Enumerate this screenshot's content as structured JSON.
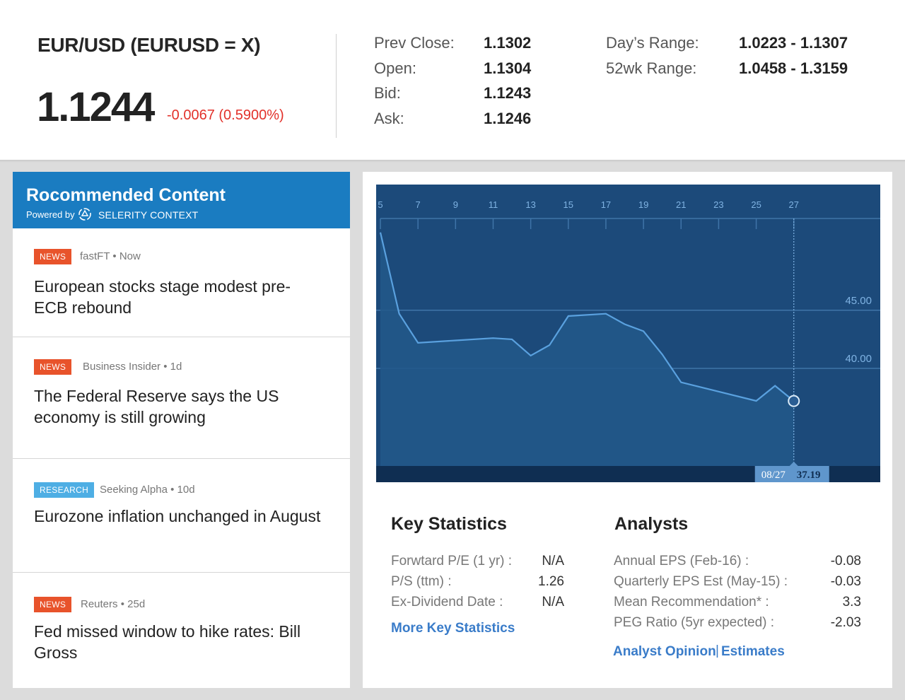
{
  "quote": {
    "name": "EUR/USD (EURUSD = X)",
    "price": "1.1244",
    "change": "-0.0067 (0.5900%)",
    "prev_close_label": "Prev Close:",
    "prev_close": "1.1302",
    "open_label": "Open:",
    "open": "1.1304",
    "bid_label": "Bid:",
    "bid": "1.1243",
    "ask_label": "Ask:",
    "ask": "1.1246",
    "days_range_label": "Day’s Range:",
    "days_range": "1.0223 - 1.1307",
    "wk52_range_label": "52wk Range:",
    "wk52_range": "1.0458 - 1.3159",
    "change_color": "#e2312a"
  },
  "recommended": {
    "title": "Rocommended Content",
    "powered_by": "Powered by",
    "brand": "SELERITY CONTEXT",
    "header_color": "#1a7cc1",
    "items": [
      {
        "tag": "NEWS",
        "tag_type": "news",
        "source": "fastFT",
        "age": "Now",
        "headline": "European stocks stage modest pre-ECB rebound"
      },
      {
        "tag": "NEWS",
        "tag_type": "news",
        "source": "Business Insider",
        "age": "1d",
        "headline": "The Federal Reserve says the US economy is still growing"
      },
      {
        "tag": "RESEARCH",
        "tag_type": "research",
        "source": "Seeking Alpha",
        "age": "10d",
        "headline": "Eurozone inflation unchanged in August"
      },
      {
        "tag": "NEWS",
        "tag_type": "news",
        "source": "Reuters",
        "age": "25d",
        "headline": "Fed missed window to hike rates: Bill Gross"
      }
    ]
  },
  "chart_data": {
    "type": "area",
    "x_ticks": [
      "5",
      "7",
      "9",
      "11",
      "13",
      "15",
      "17",
      "19",
      "21",
      "23",
      "25",
      "27"
    ],
    "y_ticks": [
      "45.00",
      "40.00"
    ],
    "x": [
      5,
      6,
      7,
      9,
      11,
      12,
      13,
      14,
      15,
      17,
      18,
      19,
      20,
      21,
      23,
      25,
      26,
      27
    ],
    "values": [
      51.7,
      44.7,
      42.2,
      42.4,
      42.6,
      42.5,
      41.1,
      42.0,
      44.5,
      44.7,
      43.8,
      43.2,
      41.2,
      38.8,
      38.0,
      37.2,
      38.5,
      37.19
    ],
    "ylim": [
      31.6,
      52.9
    ],
    "xlim": [
      5,
      31.6
    ],
    "cursor": {
      "date": "08/27",
      "value": "37.19"
    },
    "colors": {
      "background": "#1c4a7a",
      "line": "#5aa1df",
      "fill": "#225889",
      "text": "#7fb3e3"
    }
  },
  "key_statistics": {
    "title": "Key Statistics",
    "rows": [
      {
        "label": "Forwtard P/E (1 yr) :",
        "value": "N/A"
      },
      {
        "label": "P/S (ttm) :",
        "value": "1.26"
      },
      {
        "label": "Ex-Dividend Date :",
        "value": "N/A"
      }
    ],
    "more_link": "More Key Statistics"
  },
  "analysts": {
    "title": "Analysts",
    "rows": [
      {
        "label": "Annual EPS (Feb-16) :",
        "value": "-0.08"
      },
      {
        "label": "Quarterly EPS Est (May-15) :",
        "value": "-0.03"
      },
      {
        "label": "Mean Recommendation* :",
        "value": "3.3"
      },
      {
        "label": "PEG Ratio (5yr expected) :",
        "value": "-2.03"
      }
    ],
    "opinion_link": "Analyst Opinion",
    "separator": "|",
    "estimates_link": "Estimates"
  }
}
